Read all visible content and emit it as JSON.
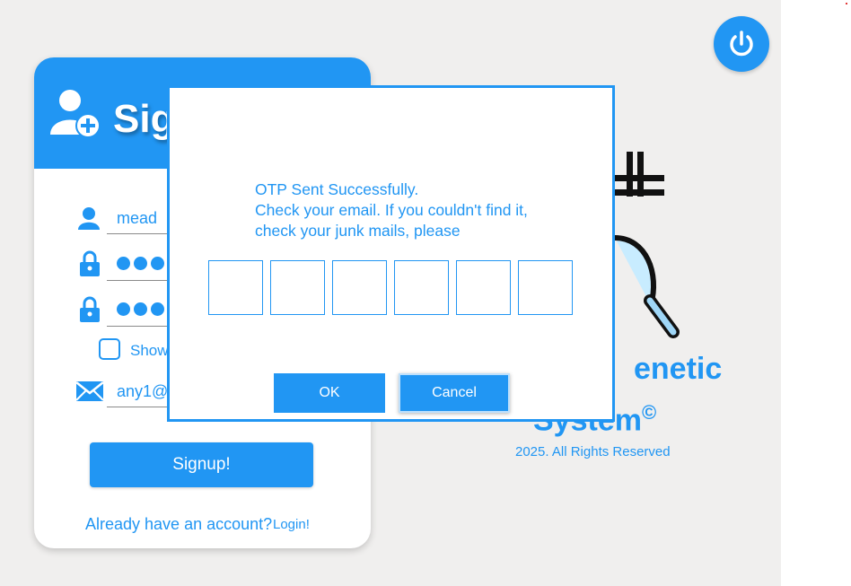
{
  "app": {
    "power_icon": "power-icon"
  },
  "signup": {
    "title": "Signup",
    "header_icon": "add-user-icon",
    "username_value": "mead",
    "password_dots": 3,
    "confirm_dots": 3,
    "show_password_label": "Show Password",
    "email_value": "any1@",
    "signup_button": "Signup!",
    "already_text": "Already have an account?",
    "login_link": "Login!"
  },
  "brand": {
    "line1": "enetic",
    "line2": "System",
    "copyright_mark": "©",
    "rights": "2025. All Rights Reserved"
  },
  "dialog": {
    "message_lines": [
      "OTP Sent Successfully.",
      "Check your email. If you couldn't find it,",
      "check your junk mails, please"
    ],
    "otp_digits": [
      "",
      "",
      "",
      "",
      "",
      ""
    ],
    "ok_label": "OK",
    "cancel_label": "Cancel"
  },
  "colors": {
    "accent": "#2196f3",
    "background": "#f0efee"
  }
}
